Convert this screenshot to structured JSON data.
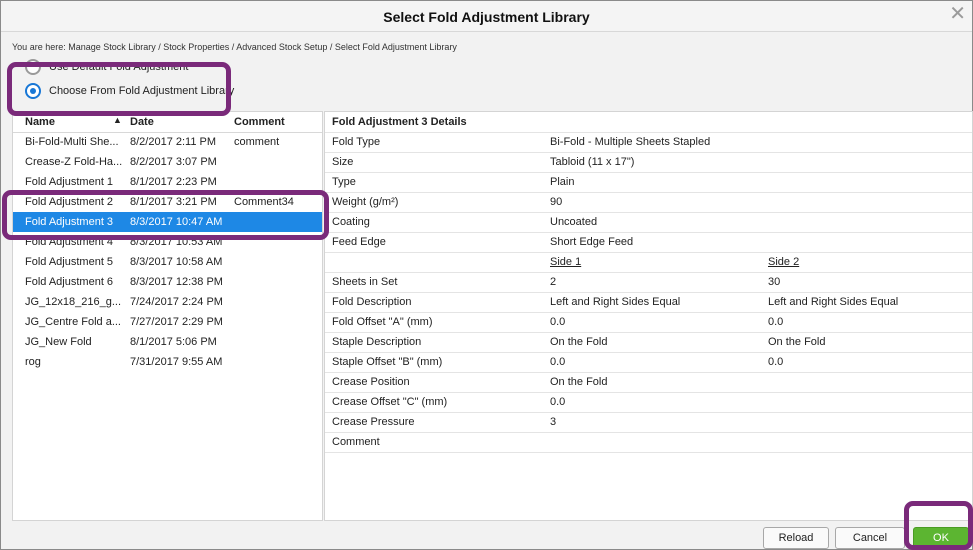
{
  "dialog": {
    "title": "Select Fold Adjustment Library"
  },
  "breadcrumb": "You are here: Manage Stock Library / Stock Properties / Advanced Stock Setup / Select Fold Adjustment Library",
  "options": {
    "default_label": "Use Default Fold Adjustment",
    "library_label": "Choose From Fold Adjustment Library",
    "selected": "library"
  },
  "list": {
    "columns": [
      "Name",
      "Date",
      "Comment"
    ],
    "sort": "Name ascending",
    "rows": [
      {
        "name": "Bi-Fold-Multi She...",
        "date": "8/2/2017 2:11 PM",
        "comment": "comment"
      },
      {
        "name": "Crease-Z Fold-Ha...",
        "date": "8/2/2017 3:07 PM",
        "comment": ""
      },
      {
        "name": "Fold Adjustment 1",
        "date": "8/1/2017 2:23 PM",
        "comment": ""
      },
      {
        "name": "Fold Adjustment 2",
        "date": "8/1/2017 3:21 PM",
        "comment": "Comment34"
      },
      {
        "name": "Fold Adjustment 3",
        "date": "8/3/2017 10:47 AM",
        "comment": "",
        "selected": true
      },
      {
        "name": "Fold Adjustment 4",
        "date": "8/3/2017 10:53 AM",
        "comment": ""
      },
      {
        "name": "Fold Adjustment 5",
        "date": "8/3/2017 10:58 AM",
        "comment": ""
      },
      {
        "name": "Fold Adjustment 6",
        "date": "8/3/2017 12:38 PM",
        "comment": ""
      },
      {
        "name": "JG_12x18_216_g...",
        "date": "7/24/2017 2:24 PM",
        "comment": ""
      },
      {
        "name": "JG_Centre Fold a...",
        "date": "7/27/2017 2:29 PM",
        "comment": ""
      },
      {
        "name": "JG_New Fold",
        "date": "8/1/2017 5:06 PM",
        "comment": ""
      },
      {
        "name": "rog",
        "date": "7/31/2017 9:55 AM",
        "comment": ""
      }
    ]
  },
  "details": {
    "header": "Fold Adjustment 3 Details",
    "rows": [
      {
        "label": "Fold Type",
        "v1": "Bi-Fold - Multiple Sheets Stapled",
        "v2": ""
      },
      {
        "label": "Size",
        "v1": "Tabloid (11 x 17\")",
        "v2": ""
      },
      {
        "label": "Type",
        "v1": "Plain",
        "v2": ""
      },
      {
        "label": "Weight (g/m²)",
        "v1": "90",
        "v2": ""
      },
      {
        "label": "Coating",
        "v1": "Uncoated",
        "v2": ""
      },
      {
        "label": "Feed Edge",
        "v1": "Short Edge Feed",
        "v2": ""
      },
      {
        "label": "",
        "v1": "Side 1",
        "v2": "Side 2",
        "underline": true
      },
      {
        "label": "Sheets in Set",
        "v1": "2",
        "v2": "30"
      },
      {
        "label": "Fold Description",
        "v1": "Left and Right Sides Equal",
        "v2": "Left and Right Sides Equal"
      },
      {
        "label": "Fold Offset \"A\" (mm)",
        "v1": "0.0",
        "v2": "0.0"
      },
      {
        "label": "Staple Description",
        "v1": "On the Fold",
        "v2": "On the Fold"
      },
      {
        "label": "Staple Offset \"B\" (mm)",
        "v1": "0.0",
        "v2": "0.0"
      },
      {
        "label": "Crease Position",
        "v1": "On the Fold",
        "v2": ""
      },
      {
        "label": "Crease Offset \"C\" (mm)",
        "v1": "0.0",
        "v2": ""
      },
      {
        "label": "Crease Pressure",
        "v1": "3",
        "v2": ""
      },
      {
        "label": "Comment",
        "v1": "",
        "v2": ""
      }
    ]
  },
  "buttons": {
    "reload": "Reload",
    "cancel": "Cancel",
    "ok": "OK"
  },
  "colors": {
    "selection": "#1e88e5",
    "accent_radio": "#1877d6",
    "ok_button": "#5cb531",
    "annotation": "#7a2a7a"
  },
  "icons": {
    "close": "close-icon",
    "sort": "sort-up-icon"
  }
}
